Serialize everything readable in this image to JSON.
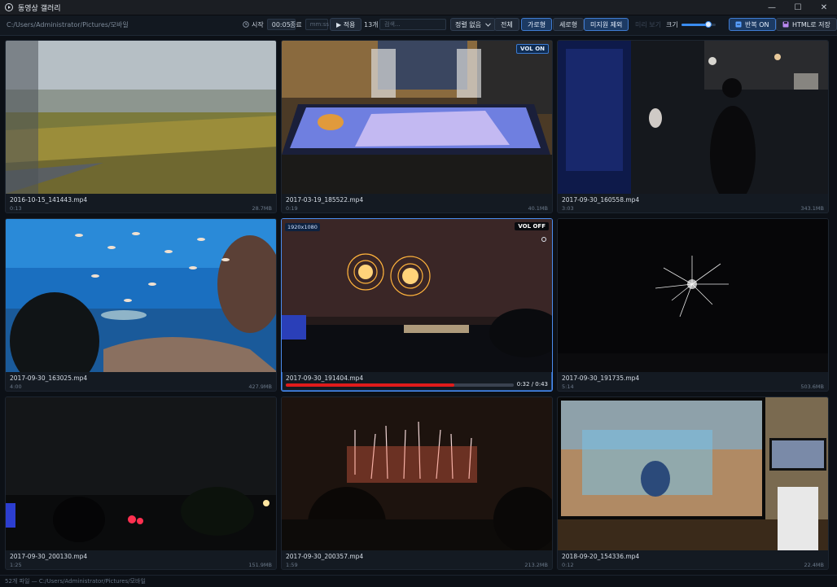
{
  "window": {
    "title": "동영상 갤러리",
    "controls": {
      "minimize": "—",
      "maximize": "☐",
      "close": "✕"
    }
  },
  "toolbar": {
    "path": "C:/Users/Administrator/Pictures/모바일",
    "start_label": "시작",
    "start_value": "00:05",
    "end_label": "종료",
    "end_placeholder": "mm:ss",
    "apply_label": "▶ 적용",
    "count_label": "13개",
    "search_placeholder": "검색...",
    "sort_value": "정렬 없음",
    "all_label": "전체",
    "landscape_label": "가로형",
    "portrait_label": "세로형",
    "unsupported_label": "미지원 제외",
    "disabled_label": "미리 보기",
    "size_label": "크기",
    "size_level": 0.8,
    "repeat_label": "반복 ON",
    "save_html_label": "HTML로 저장"
  },
  "videos": [
    {
      "name": "2016-10-15_141443.mp4",
      "duration": "0:13",
      "size": "28.7MB"
    },
    {
      "name": "2017-03-19_185522.mp4",
      "duration": "0:19",
      "size": "40.1MB",
      "badge": "VOL ON"
    },
    {
      "name": "2017-09-30_160558.mp4",
      "duration": "3:03",
      "size": "343.1MB"
    },
    {
      "name": "2017-09-30_163025.mp4",
      "duration": "4:00",
      "size": "427.9MB"
    },
    {
      "name": "2017-09-30_191404.mp4",
      "resolution": "1920x1080",
      "badge": "VOL OFF",
      "time": "0:32 / 0:43",
      "progress": 0.74
    },
    {
      "name": "2017-09-30_191735.mp4",
      "duration": "5:14",
      "size": "503.6MB"
    },
    {
      "name": "2017-09-30_200130.mp4",
      "duration": "1:25",
      "size": "151.9MB"
    },
    {
      "name": "2017-09-30_200357.mp4",
      "duration": "1:59",
      "size": "213.2MB"
    },
    {
      "name": "2018-09-20_154336.mp4",
      "duration": "0:12",
      "size": "22.4MB"
    }
  ],
  "status": {
    "text": "52개 파일 — C:/Users/Administrator/Pictures/모바일"
  },
  "colors": {
    "accent": "#3a8cf0",
    "progress": "#e01b1b",
    "background": "#0c1016"
  }
}
